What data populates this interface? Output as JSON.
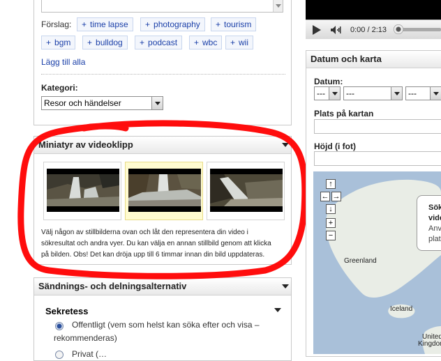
{
  "tags": {
    "label": "Förslag:",
    "items": [
      "time lapse",
      "photography",
      "tourism",
      "bgm",
      "bulldog",
      "podcast",
      "wbc",
      "wii"
    ],
    "add_all": "Lägg till alla"
  },
  "category": {
    "label": "Kategori:",
    "selected": "Resor och händelser"
  },
  "thumbnails": {
    "title": "Miniatyr av videoklipp",
    "help_text_lines": [
      "Välj någon av stillbilderna ovan och låt den representera din video i",
      "sökresultat och andra vyer. Du kan välja en annan stillbild genom att klicka",
      "på bilden. Obs! Det kan dröja upp till 6 timmar innan din bild uppdateras."
    ],
    "selected_index": 1
  },
  "sharing": {
    "title": "Sändnings- och delningsalternativ",
    "privacy_label": "Sekretess",
    "option_public_line1": "Offentligt (vem som helst kan söka efter och visa –",
    "option_public_line2": "rekommenderas)",
    "option_private_partial": "Privat (…"
  },
  "player": {
    "time": "0:00 / 2:13"
  },
  "date_map": {
    "title": "Datum och karta",
    "date_label": "Datum:",
    "date_day": "---",
    "date_month": "---",
    "date_year": "---",
    "place_label": "Plats på kartan",
    "height_label": "Höjd (i fot)"
  },
  "map": {
    "labels": [
      "Greenland",
      "Iceland",
      "United",
      "Kingdom"
    ],
    "bubble_lines": [
      "Sök",
      "vide",
      "Anv",
      "plat"
    ]
  },
  "colors": {
    "link": "#1a3fa8",
    "annotation_red": "#ff0000",
    "map_water": "#a9c0d9",
    "map_land": "#e9ede6"
  }
}
